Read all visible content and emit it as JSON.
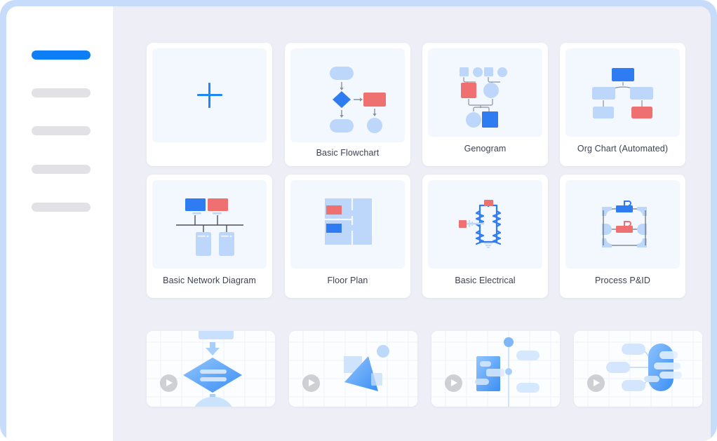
{
  "window": {
    "frame_color": "#c7dbfb",
    "canvas_color": "#edeef6",
    "sidebar_color": "#ffffff"
  },
  "sidebar": {
    "items": [
      {
        "name": "nav-item-1",
        "state": "active",
        "color": "#0c7ff7"
      },
      {
        "name": "nav-item-2",
        "state": "inactive",
        "color": "#e2e2e6"
      },
      {
        "name": "nav-item-3",
        "state": "inactive",
        "color": "#e2e2e6"
      },
      {
        "name": "nav-item-4",
        "state": "inactive",
        "color": "#e2e2e6"
      },
      {
        "name": "nav-item-5",
        "state": "inactive",
        "color": "#e2e2e6"
      }
    ]
  },
  "main": {
    "new_document": {
      "icon": "plus-icon",
      "label": ""
    },
    "templates": [
      {
        "id": "basic-flowchart",
        "label": "Basic Flowchart",
        "thumb": "flowchart"
      },
      {
        "id": "genogram",
        "label": "Genogram",
        "thumb": "genogram"
      },
      {
        "id": "org-chart",
        "label": "Org Chart (Automated)",
        "thumb": "orgchart"
      },
      {
        "id": "basic-network",
        "label": "Basic Network Diagram",
        "thumb": "network"
      },
      {
        "id": "floor-plan",
        "label": "Floor Plan",
        "thumb": "floorplan"
      },
      {
        "id": "basic-electrical",
        "label": "Basic Electrical",
        "thumb": "electrical"
      },
      {
        "id": "process-pid",
        "label": "Process P&ID",
        "thumb": "pid"
      }
    ],
    "videos": [
      {
        "id": "video-1",
        "thumb": "diamond-flow",
        "play_icon": "play-icon"
      },
      {
        "id": "video-2",
        "thumb": "shapes",
        "play_icon": "play-icon"
      },
      {
        "id": "video-3",
        "thumb": "timeline",
        "play_icon": "play-icon"
      },
      {
        "id": "video-4",
        "thumb": "mindmap",
        "play_icon": "play-icon"
      }
    ]
  },
  "palette": {
    "blue": "#2f7bf1",
    "light_blue": "#bcd7fa",
    "red": "#ef7070",
    "line_gray": "#8b919c",
    "thumb_bg": "#f3f8fe",
    "text": "#3b4252"
  }
}
